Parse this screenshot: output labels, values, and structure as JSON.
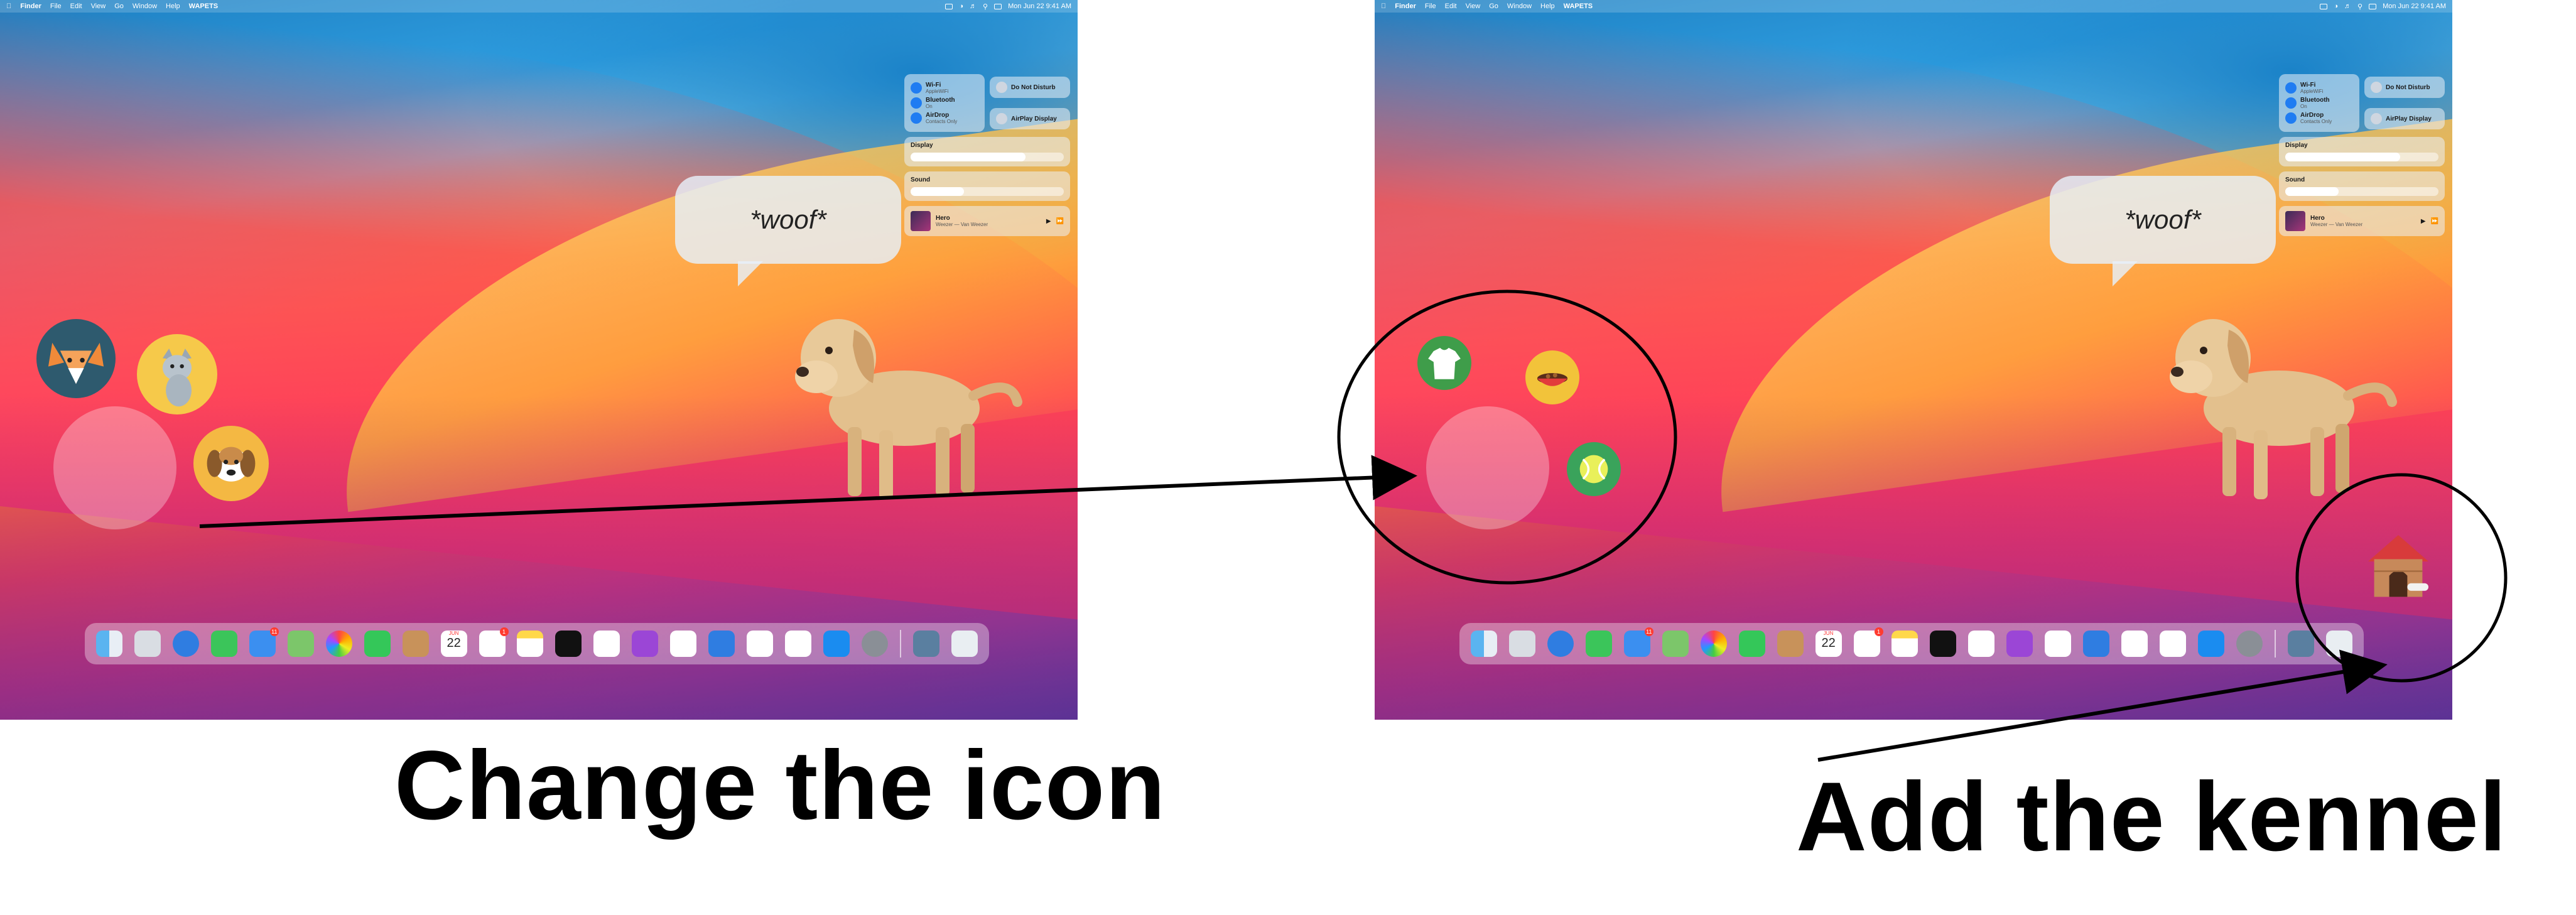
{
  "left_screen": {
    "menubar": {
      "items": [
        "Finder",
        "File",
        "Edit",
        "View",
        "Go",
        "Window",
        "Help",
        "WAPETS"
      ],
      "clock": "Mon Jun 22 9:41 AM"
    },
    "control_center": {
      "wifi": {
        "label": "Wi-Fi",
        "sub": "AppleWiFi"
      },
      "bluetooth": {
        "label": "Bluetooth",
        "sub": "On"
      },
      "airdrop": {
        "label": "AirDrop",
        "sub": "Contacts Only"
      },
      "dnd": {
        "label": "Do Not Disturb"
      },
      "airplay": {
        "label": "AirPlay Display"
      },
      "display": {
        "label": "Display",
        "level": 0.75
      },
      "sound": {
        "label": "Sound",
        "level": 0.35
      },
      "now_playing": {
        "title": "Hero",
        "artist": "Weezer — Van Weezer"
      }
    },
    "speech": "*woof*",
    "pet_icons": [
      "fox-icon",
      "cat-icon",
      "dog-icon"
    ]
  },
  "right_screen": {
    "menubar": {
      "items": [
        "Finder",
        "File",
        "Edit",
        "View",
        "Go",
        "Window",
        "Help",
        "WAPETS"
      ],
      "clock": "Mon Jun 22 9:41 AM"
    },
    "control_center": {
      "wifi": {
        "label": "Wi-Fi",
        "sub": "AppleWiFi"
      },
      "bluetooth": {
        "label": "Bluetooth",
        "sub": "On"
      },
      "airdrop": {
        "label": "AirDrop",
        "sub": "Contacts Only"
      },
      "dnd": {
        "label": "Do Not Disturb"
      },
      "airplay": {
        "label": "AirPlay Display"
      },
      "display": {
        "label": "Display",
        "level": 0.75
      },
      "sound": {
        "label": "Sound",
        "level": 0.35
      },
      "now_playing": {
        "title": "Hero",
        "artist": "Weezer — Van Weezer"
      }
    },
    "speech": "*woof*",
    "pet_icons": [
      "tshirt-icon",
      "food-bowl-icon",
      "tennis-ball-icon"
    ],
    "kennel": "kennel-icon"
  },
  "dock": {
    "calendar_month": "JUN",
    "calendar_day": "22",
    "mail_badge": "11",
    "reminders_badge": "1"
  },
  "captions": {
    "left": "Change the icon",
    "right": "Add the kennel"
  },
  "colors": {
    "fox": "#f08a3a",
    "cat_bg": "#f6c94a",
    "dog_bg": "#f4b843",
    "tshirt_bg": "#3f9d4a",
    "bowl_bg": "#f2c33a",
    "ball_bg": "#3aa35b"
  }
}
